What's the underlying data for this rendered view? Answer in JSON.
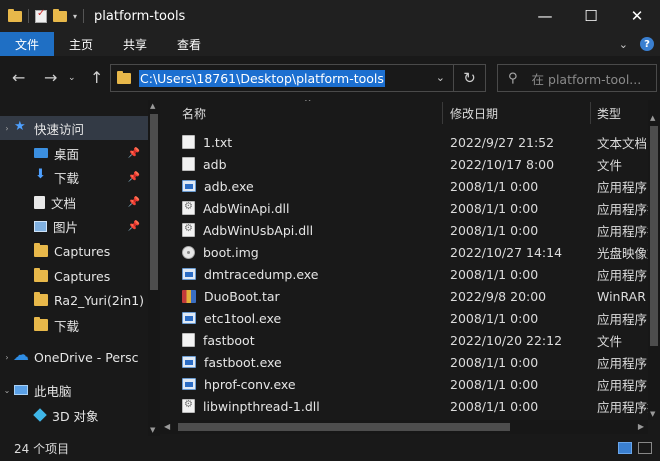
{
  "window": {
    "title": "platform-tools",
    "controls": {
      "minimize": "—",
      "maximize": "☐",
      "close": "✕"
    }
  },
  "ribbon": {
    "tabs": [
      "文件",
      "主页",
      "共享",
      "查看"
    ]
  },
  "nav": {
    "address": "C:\\Users\\18761\\Desktop\\platform-tools",
    "search_placeholder": "在 platform-tool..."
  },
  "sidebar": {
    "items": [
      {
        "label": "快速访问",
        "icon": "star-icon",
        "pinned": false
      },
      {
        "label": "桌面",
        "icon": "desktop-icon",
        "pinned": true
      },
      {
        "label": "下载",
        "icon": "download-icon",
        "pinned": true
      },
      {
        "label": "文档",
        "icon": "document-icon",
        "pinned": true
      },
      {
        "label": "图片",
        "icon": "picture-icon",
        "pinned": true
      },
      {
        "label": "Captures",
        "icon": "folder-icon",
        "pinned": false
      },
      {
        "label": "Captures",
        "icon": "folder-icon",
        "pinned": false
      },
      {
        "label": "Ra2_Yuri(2in1)",
        "icon": "folder-icon",
        "pinned": false
      },
      {
        "label": "下载",
        "icon": "folder-icon",
        "pinned": false
      },
      {
        "label": "OneDrive - Persc",
        "icon": "cloud-icon",
        "pinned": false
      },
      {
        "label": "此电脑",
        "icon": "computer-icon",
        "pinned": false
      },
      {
        "label": "3D 对象",
        "icon": "cube-icon",
        "pinned": false
      }
    ]
  },
  "columns": {
    "name": "名称",
    "date": "修改日期",
    "type": "类型"
  },
  "files": [
    {
      "name": "1.txt",
      "date": "2022/9/27 21:52",
      "type": "文本文档",
      "icon": "txt"
    },
    {
      "name": "adb",
      "date": "2022/10/17 8:00",
      "type": "文件",
      "icon": "blank"
    },
    {
      "name": "adb.exe",
      "date": "2008/1/1 0:00",
      "type": "应用程序",
      "icon": "exe"
    },
    {
      "name": "AdbWinApi.dll",
      "date": "2008/1/1 0:00",
      "type": "应用程序扩展",
      "icon": "dll"
    },
    {
      "name": "AdbWinUsbApi.dll",
      "date": "2008/1/1 0:00",
      "type": "应用程序扩展",
      "icon": "dll"
    },
    {
      "name": "boot.img",
      "date": "2022/10/27 14:14",
      "type": "光盘映像文件",
      "icon": "img"
    },
    {
      "name": "dmtracedump.exe",
      "date": "2008/1/1 0:00",
      "type": "应用程序",
      "icon": "exe"
    },
    {
      "name": "DuoBoot.tar",
      "date": "2022/9/8 20:00",
      "type": "WinRAR",
      "icon": "rar"
    },
    {
      "name": "etc1tool.exe",
      "date": "2008/1/1 0:00",
      "type": "应用程序",
      "icon": "exe"
    },
    {
      "name": "fastboot",
      "date": "2022/10/20 22:12",
      "type": "文件",
      "icon": "blank"
    },
    {
      "name": "fastboot.exe",
      "date": "2008/1/1 0:00",
      "type": "应用程序",
      "icon": "exe"
    },
    {
      "name": "hprof-conv.exe",
      "date": "2008/1/1 0:00",
      "type": "应用程序",
      "icon": "exe"
    },
    {
      "name": "libwinpthread-1.dll",
      "date": "2008/1/1 0:00",
      "type": "应用程序扩展",
      "icon": "dll"
    }
  ],
  "status": {
    "count": "24 个项目"
  },
  "colors": {
    "accent": "#1f6fc4",
    "background": "#191919",
    "selection": "#1c6fd0"
  }
}
